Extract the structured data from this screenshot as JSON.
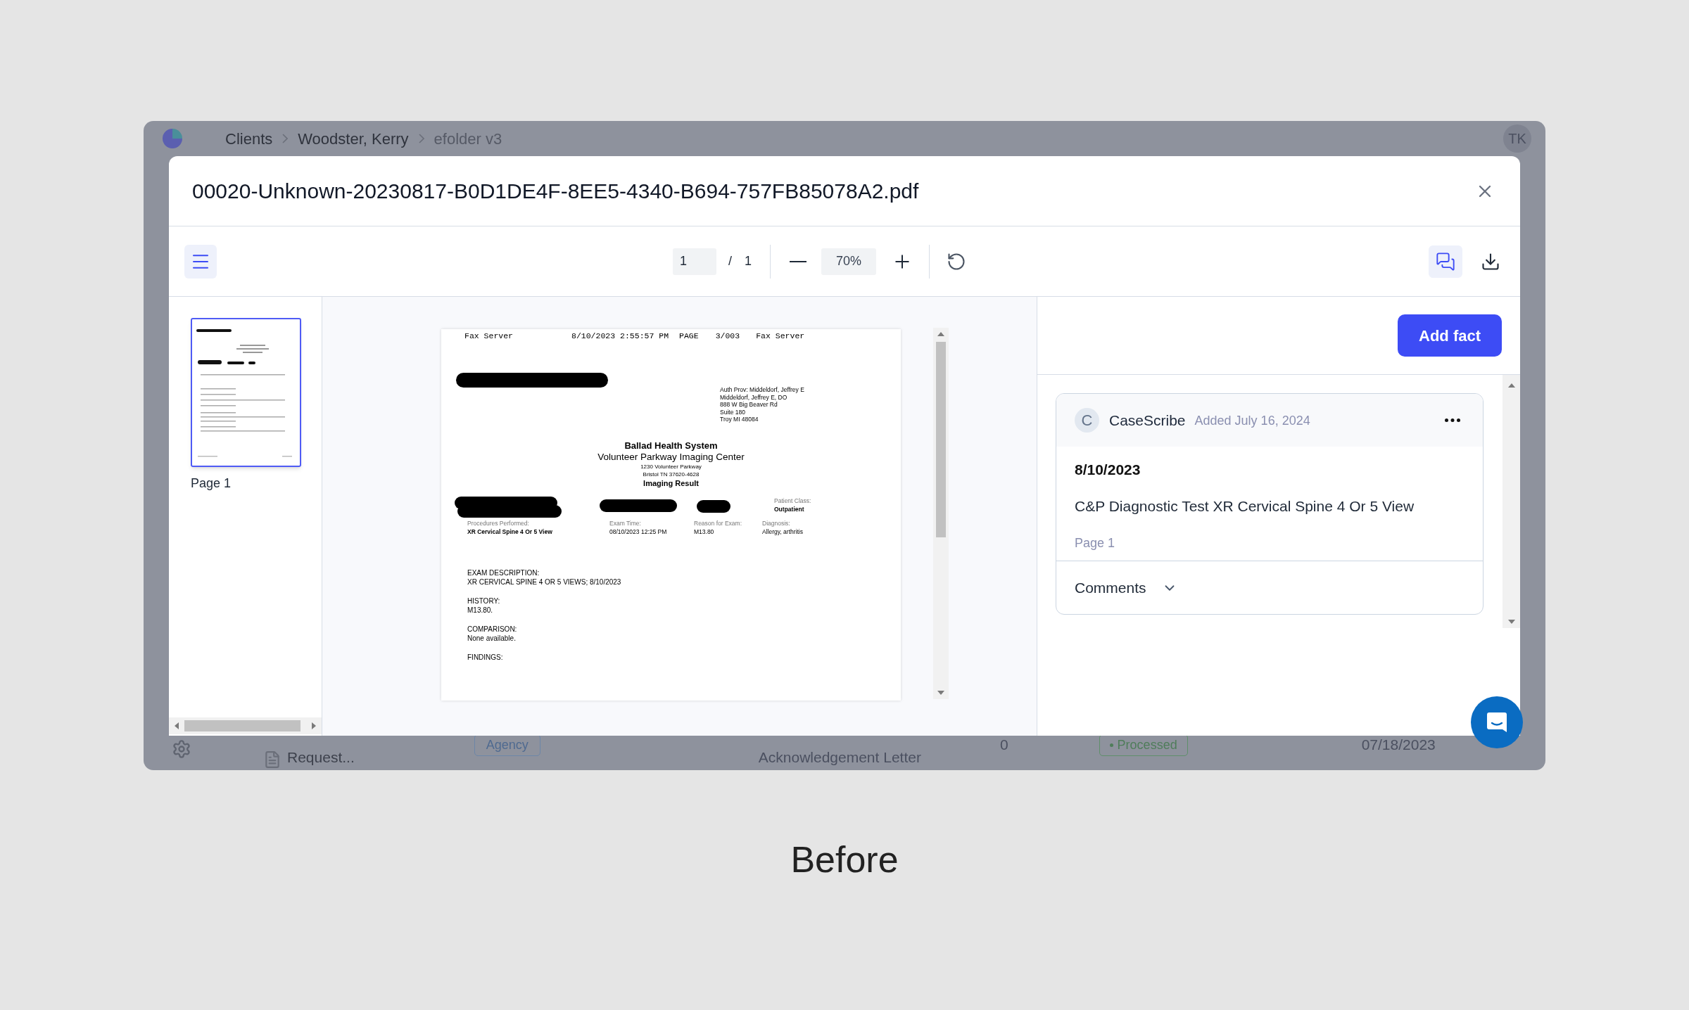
{
  "app": {
    "breadcrumbs": [
      {
        "label": "Clients",
        "current": false
      },
      {
        "label": "Woodster, Kerry",
        "current": false
      },
      {
        "label": "efolder v3",
        "current": true
      }
    ],
    "avatar": "TK",
    "row": {
      "name": "Request...",
      "tag": "Agency",
      "description": "Acknowledgement Letter",
      "count": "0",
      "status": "Processed",
      "date": "07/18/2023"
    }
  },
  "dialog": {
    "title": "00020-Unknown-20230817-B0D1DE4F-8EE5-4340-B694-757FB85078A2.pdf",
    "toolbar": {
      "sidebar_open": true,
      "page": "1",
      "separator": "/",
      "page_count": "1",
      "zoom": "70%",
      "comments_open": true
    },
    "thumbnails": [
      {
        "label": "Page 1",
        "selected": true
      }
    ],
    "document": {
      "header": [
        "Fax Server",
        "8/10/2023 2:55:57 PM",
        "PAGE",
        "3/003",
        "Fax Server"
      ],
      "address": [
        "Auth Prov: Middeldorf, Jeffrey E",
        "Middeldorf, Jeffrey E, DO",
        "888 W Big Beaver Rd",
        "Suite 180",
        "Troy MI 48084"
      ],
      "org": "Ballad Health System",
      "center": "Volunteer Parkway Imaging Center",
      "center_address": [
        "1230 Volunteer Parkway",
        "Bristol TN 37620-4628"
      ],
      "doc_title": "Imaging Result",
      "patient_class": {
        "label": "Patient Class:",
        "value": "Outpatient"
      },
      "fields": [
        {
          "label": "Procedures Performed:",
          "value": "XR Cervical Spine 4 Or 5 View"
        },
        {
          "label": "Exam Time:",
          "value": "08/10/2023 12:25 PM"
        },
        {
          "label": "Reason for Exam:",
          "value": "M13.80"
        },
        {
          "label": "Diagnosis:",
          "value": "Allergy, arthritis"
        }
      ],
      "sections": [
        {
          "heading": "EXAM DESCRIPTION:",
          "text": "XR CERVICAL SPINE 4 OR 5 VIEWS; 8/10/2023"
        },
        {
          "heading": "HISTORY:",
          "text": "M13.80."
        },
        {
          "heading": "COMPARISON:",
          "text": "None available."
        },
        {
          "heading": "FINDINGS:"
        }
      ]
    },
    "facts_panel": {
      "add_button": "Add fact",
      "facts": [
        {
          "avatar": "C",
          "author": "CaseScribe",
          "added": "Added July 16, 2024",
          "date": "8/10/2023",
          "description": "C&P Diagnostic Test XR Cervical Spine 4 Or 5 View",
          "page": "Page 1",
          "comments": "Comments",
          "comments_expanded": false
        }
      ]
    }
  },
  "caption": "Before"
}
